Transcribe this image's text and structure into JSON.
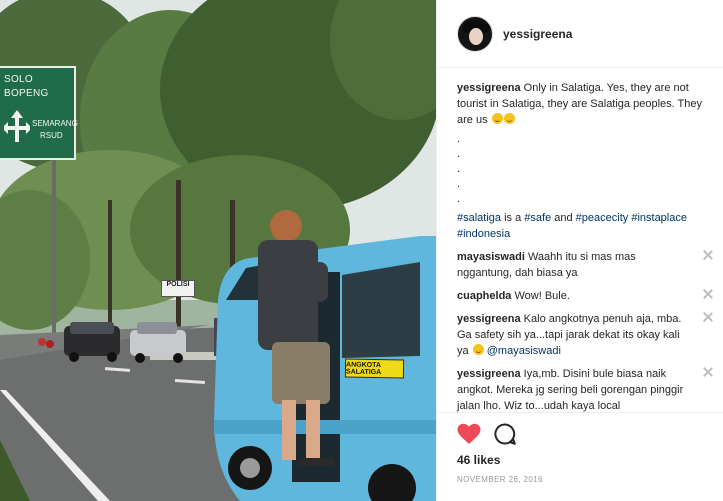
{
  "photo": {
    "road_sign": {
      "line1": "SOLO",
      "line2": "BOPENG",
      "line3": "SEMARANG",
      "line4": "RSUD"
    },
    "police_sign": "POLISI",
    "van_label": "ANGKOTA SALATIGA"
  },
  "header": {
    "username": "yessigreena"
  },
  "caption": {
    "username": "yessigreena",
    "text": "Only in Salatiga. Yes, they are not tourist in Salatiga, they are Salatiga peoples. They are us",
    "dots": [
      ".",
      ".",
      ".",
      ".",
      "."
    ],
    "tags": {
      "t1": "#salatiga",
      "w1": " is a ",
      "t2": "#safe",
      "w2": " and ",
      "t3": "#peacecity",
      "t4": "#instaplace",
      "t5": "#indonesia"
    }
  },
  "comments": [
    {
      "username": "mayasiswadi",
      "text": "Waahh itu si mas mas nggantung, dah biasa ya"
    },
    {
      "username": "cuaphelda",
      "text": "Wow! Bule."
    },
    {
      "username": "yessigreena",
      "text": "Kalo angkotnya penuh aja, mba. Ga safety sih ya...tapi jarak dekat its okay kali ya",
      "mention": "@mayasiswadi"
    },
    {
      "username": "yessigreena",
      "text": "Iya,mb. Disini bule biasa naik angkot. Mereka jg sering beli gorengan pinggir jalan lho. Wiz to...udah kaya local"
    }
  ],
  "likes": "46 likes",
  "date": "NOVEMBER 26, 2016",
  "colors": {
    "link": "#003569",
    "heart": "#ed4956",
    "van": "#5fb7de"
  }
}
